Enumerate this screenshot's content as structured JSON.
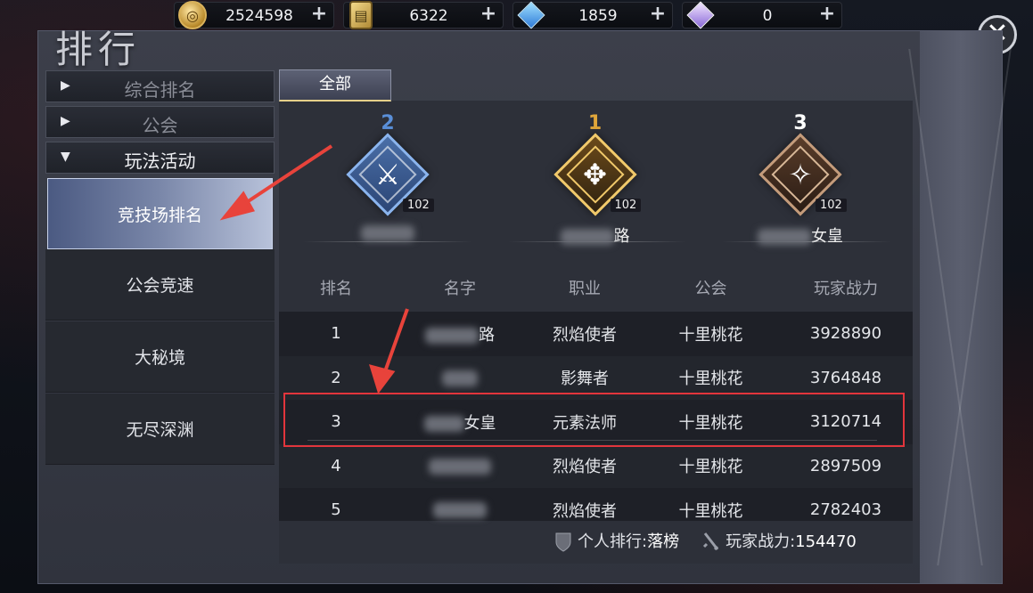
{
  "resources": [
    {
      "icon": "gold-coin-icon",
      "value": "2524598"
    },
    {
      "icon": "ticket-icon",
      "value": "6322"
    },
    {
      "icon": "locked-crystal-icon",
      "value": "1859"
    },
    {
      "icon": "purple-crystal-icon",
      "value": "0"
    }
  ],
  "title": "排行",
  "categories": [
    {
      "label": "综合排名",
      "icon": "triangle-right-icon"
    },
    {
      "label": "公会",
      "icon": "triangle-right-icon"
    },
    {
      "label": "玩法活动",
      "icon": "triangle-down-icon"
    }
  ],
  "sub_items": [
    "竞技场排名",
    "公会竞速",
    "大秘境",
    "无尽深渊"
  ],
  "tab_all": "全部",
  "podium": [
    {
      "rank": "2",
      "level": "102",
      "name_suffix": "",
      "color": "#5a8fd8"
    },
    {
      "rank": "1",
      "level": "102",
      "name_suffix": "路",
      "color": "#e0a63a"
    },
    {
      "rank": "3",
      "level": "102",
      "name_suffix": "女皇",
      "color": "#a07858"
    }
  ],
  "table": {
    "headers": [
      "排名",
      "名字",
      "职业",
      "公会",
      "玩家战力"
    ],
    "rows": [
      {
        "rank": "1",
        "name": "路",
        "class": "烈焰使者",
        "guild": "十里桃花",
        "power": "3928890"
      },
      {
        "rank": "2",
        "name": "",
        "class": "影舞者",
        "guild": "十里桃花",
        "power": "3764848"
      },
      {
        "rank": "3",
        "name": "女皇",
        "class": "元素法师",
        "guild": "十里桃花",
        "power": "3120714"
      },
      {
        "rank": "4",
        "name": "",
        "class": "烈焰使者",
        "guild": "十里桃花",
        "power": "2897509"
      },
      {
        "rank": "5",
        "name": "",
        "class": "烈焰使者",
        "guild": "十里桃花",
        "power": "2782403"
      }
    ]
  },
  "footer": {
    "personal_rank_label": "个人排行:",
    "personal_rank_value": "落榜",
    "power_label": "玩家战力:",
    "power_value": "154470"
  },
  "colors": {
    "highlight_box": "#e2353c",
    "annotation_arrow": "#e8433b"
  }
}
